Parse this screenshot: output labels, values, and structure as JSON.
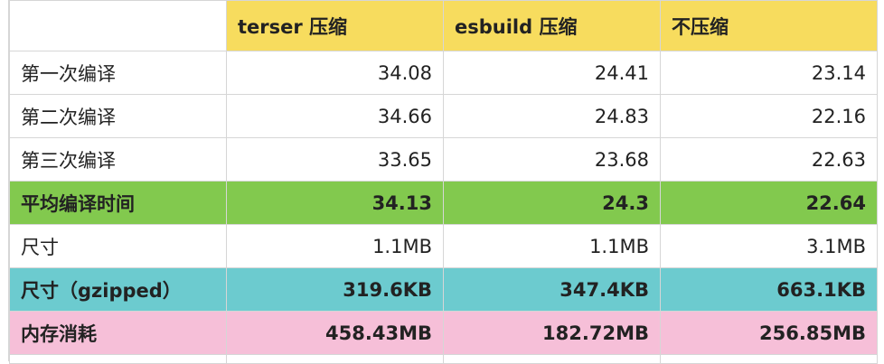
{
  "table": {
    "columns": [
      "",
      "terser 压缩",
      "esbuild 压缩",
      "不压缩"
    ],
    "rows": [
      {
        "label": "第一次编译",
        "values": [
          "34.08",
          "24.41",
          "23.14"
        ]
      },
      {
        "label": "第二次编译",
        "values": [
          "34.66",
          "24.83",
          "22.16"
        ]
      },
      {
        "label": "第三次编译",
        "values": [
          "33.65",
          "23.68",
          "22.63"
        ]
      },
      {
        "label": "平均编译时间",
        "values": [
          "34.13",
          "24.3",
          "22.64"
        ]
      },
      {
        "label": "尺寸",
        "values": [
          "1.1MB",
          "1.1MB",
          "3.1MB"
        ]
      },
      {
        "label": "尺寸（gzipped）",
        "values": [
          "319.6KB",
          "347.4KB",
          "663.1KB"
        ]
      },
      {
        "label": "内存消耗",
        "values": [
          "458.43MB",
          "182.72MB",
          "256.85MB"
        ]
      }
    ]
  },
  "colors": {
    "header_highlight": "#f7dc5e",
    "average_row": "#82c94e",
    "gzipped_row": "#6ccbcf",
    "memory_row": "#f6bfd8",
    "gridline": "#d6d6d6"
  }
}
